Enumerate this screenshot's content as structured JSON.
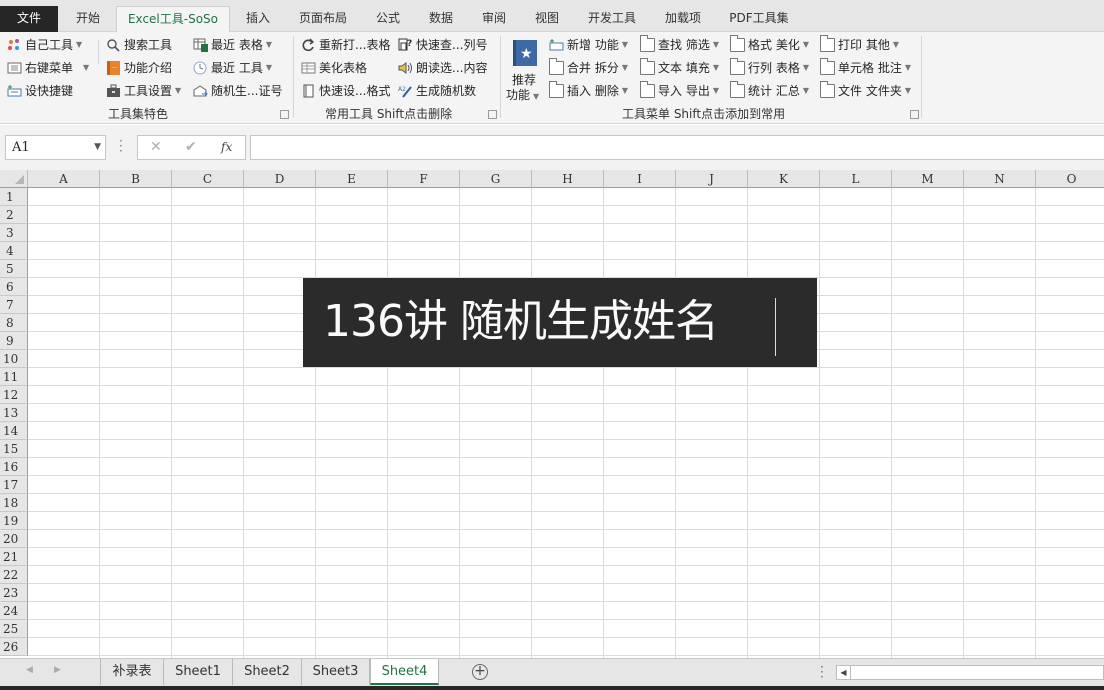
{
  "ribbon_tabs": [
    {
      "label": "文件",
      "type": "file"
    },
    {
      "label": "开始"
    },
    {
      "label": "Excel工具-SoSo",
      "active": true
    },
    {
      "label": "插入"
    },
    {
      "label": "页面布局"
    },
    {
      "label": "公式"
    },
    {
      "label": "数据"
    },
    {
      "label": "审阅"
    },
    {
      "label": "视图"
    },
    {
      "label": "开发工具"
    },
    {
      "label": "加载项"
    },
    {
      "label": "PDF工具集"
    }
  ],
  "groups": {
    "g1": {
      "label": "工具集特色",
      "items": [
        {
          "label": "自己工具",
          "icon": "dots-palette-icon",
          "dropdown": true
        },
        {
          "label": "右键菜单",
          "icon": "context-menu-icon",
          "dropdown": true
        },
        {
          "label": "设快捷键",
          "icon": "keyboard-shortcut-icon"
        },
        {
          "label": "搜索工具",
          "icon": "search-icon"
        },
        {
          "label": "功能介绍",
          "icon": "book-icon"
        },
        {
          "label": "工具设置",
          "icon": "toolbox-icon",
          "dropdown": true
        },
        {
          "label": "最近  表格",
          "icon": "excel-table-icon",
          "dropdown": true
        },
        {
          "label": "最近  工具",
          "icon": "clock-icon",
          "dropdown": true
        },
        {
          "label": "随机生...证号",
          "icon": "id-card-icon"
        }
      ]
    },
    "g2": {
      "label": "常用工具 Shift点击删除",
      "items": [
        {
          "label": "重新打...表格",
          "icon": "refresh-icon"
        },
        {
          "label": "美化表格",
          "icon": "table-format-icon"
        },
        {
          "label": "快速设...格式",
          "icon": "document-icon"
        },
        {
          "label": "快速查...列号",
          "icon": "lookup-icon"
        },
        {
          "label": "朗读选...内容",
          "icon": "speaker-icon"
        },
        {
          "label": "生成随机数",
          "icon": "random-number-icon"
        }
      ]
    },
    "g3": {
      "label": "工具菜单 Shift点击添加到常用",
      "big_button": {
        "line1": "推荐",
        "line2": "功能"
      },
      "items": [
        {
          "label": "新增 功能"
        },
        {
          "label": "合并 拆分"
        },
        {
          "label": "插入 删除"
        },
        {
          "label": "查找 筛选"
        },
        {
          "label": "文本 填充"
        },
        {
          "label": "导入 导出"
        },
        {
          "label": "格式 美化"
        },
        {
          "label": "行列 表格"
        },
        {
          "label": "统计 汇总"
        },
        {
          "label": "打印 其他"
        },
        {
          "label": "单元格 批注"
        },
        {
          "label": "文件 文件夹"
        }
      ]
    }
  },
  "formula_bar": {
    "name_box": "A1",
    "cancel": "✕",
    "enter": "✔",
    "fx": "fx",
    "value": ""
  },
  "columns": [
    "A",
    "B",
    "C",
    "D",
    "E",
    "F",
    "G",
    "H",
    "I",
    "J",
    "K",
    "L",
    "M",
    "N",
    "O"
  ],
  "rows": [
    "1",
    "2",
    "3",
    "4",
    "5",
    "6",
    "7",
    "8",
    "9",
    "10",
    "11",
    "12",
    "13",
    "14",
    "15",
    "16",
    "17",
    "18",
    "19",
    "20",
    "21",
    "22",
    "23",
    "24",
    "25",
    "26"
  ],
  "overlay_title": "136讲 随机生成姓名",
  "sheets": [
    {
      "label": "补录表"
    },
    {
      "label": "Sheet1"
    },
    {
      "label": "Sheet2"
    },
    {
      "label": "Sheet3"
    },
    {
      "label": "Sheet4",
      "active": true
    }
  ],
  "colors": {
    "accent": "#217346",
    "file_tab": "#262626",
    "overlay": "#2b2b2b"
  }
}
